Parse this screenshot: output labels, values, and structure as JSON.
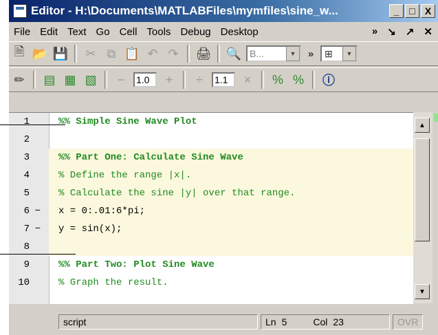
{
  "window": {
    "title": "Editor - H:\\Documents\\MATLABFiles\\mymfiles\\sine_w...",
    "controls": [
      "_",
      "□",
      "X"
    ]
  },
  "menubar": {
    "items": [
      "File",
      "Edit",
      "Text",
      "Go",
      "Cell",
      "Tools",
      "Debug",
      "Desktop"
    ],
    "right": [
      "»",
      "↘",
      "↗",
      "✕"
    ]
  },
  "toolbar1": {
    "search_placeholder": "B...",
    "more": "»"
  },
  "toolbar2": {
    "minus": "−",
    "increment_value": "1.0",
    "plus": "+",
    "divide": "÷",
    "divide_value": "1.1",
    "times": "×"
  },
  "editor": {
    "lines": [
      {
        "num": "1",
        "mark": "",
        "text": "%% Simple Sine Wave Plot",
        "kind": "cell"
      },
      {
        "num": "2",
        "mark": "",
        "text": "",
        "kind": "plain"
      },
      {
        "num": "3",
        "mark": "",
        "text": "%% Part One: Calculate Sine Wave",
        "kind": "cell"
      },
      {
        "num": "4",
        "mark": "",
        "text": "% Define the range |x|.",
        "kind": "comment"
      },
      {
        "num": "5",
        "mark": "",
        "text": "% Calculate the sine |y| over that range.",
        "kind": "comment"
      },
      {
        "num": "6",
        "mark": "−",
        "text": "x = 0:.01:6*pi;",
        "kind": "plain"
      },
      {
        "num": "7",
        "mark": "−",
        "text": "y = sin(x);",
        "kind": "plain"
      },
      {
        "num": "8",
        "mark": "",
        "text": "",
        "kind": "plain"
      },
      {
        "num": "9",
        "mark": "",
        "text": "%% Part Two: Plot Sine Wave",
        "kind": "cell"
      },
      {
        "num": "10",
        "mark": "",
        "text": "% Graph the result.",
        "kind": "comment"
      }
    ]
  },
  "status": {
    "mode": "script",
    "ln_label": "Ln",
    "ln": "5",
    "col_label": "Col",
    "col": "23",
    "ovr": "OVR"
  }
}
